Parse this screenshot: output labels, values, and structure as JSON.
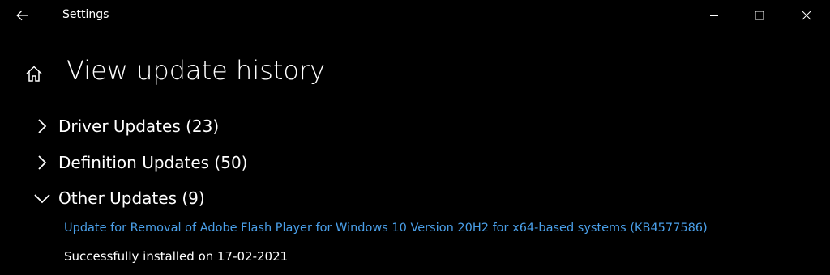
{
  "window": {
    "title": "Settings",
    "back_icon": "back-arrow-icon",
    "minimize_icon": "minimize-icon",
    "maximize_icon": "maximize-icon",
    "close_icon": "close-icon"
  },
  "page": {
    "home_icon": "home-icon",
    "title": "View update history"
  },
  "groups": [
    {
      "label": "Driver Updates (23)",
      "expanded": false,
      "icon": "chevron-right-icon"
    },
    {
      "label": "Definition Updates (50)",
      "expanded": false,
      "icon": "chevron-right-icon"
    },
    {
      "label": "Other Updates (9)",
      "expanded": true,
      "icon": "chevron-down-icon"
    }
  ],
  "other_updates": [
    {
      "name": "Update for Removal of Adobe Flash Player for Windows 10 Version 20H2 for x64-based systems (KB4577586)",
      "status": "Successfully installed on 17-02-2021"
    }
  ],
  "colors": {
    "background": "#000000",
    "text": "#ffffff",
    "link": "#4a9fe8"
  }
}
